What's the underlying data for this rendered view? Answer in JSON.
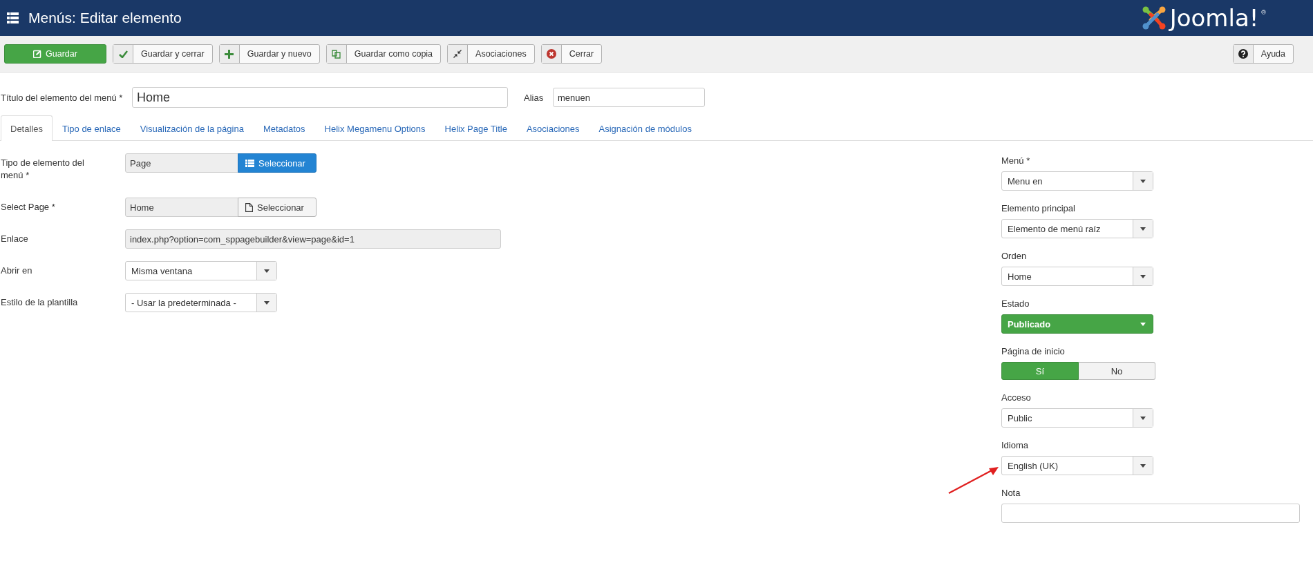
{
  "header": {
    "title": "Menús: Editar elemento",
    "logo_text": "Joomla!",
    "logo_mark": "®"
  },
  "toolbar": {
    "buttons": [
      {
        "label": "Guardar",
        "kind": "save"
      },
      {
        "label": "Guardar y cerrar",
        "kind": "save-close"
      },
      {
        "label": "Guardar y nuevo",
        "kind": "save-new"
      },
      {
        "label": "Guardar como copia",
        "kind": "save-copy"
      },
      {
        "label": "Asociaciones",
        "kind": "associations"
      },
      {
        "label": "Cerrar",
        "kind": "close"
      }
    ],
    "help": {
      "label": "Ayuda"
    }
  },
  "title_field": {
    "label": "Título del elemento del menú *",
    "value": "Home"
  },
  "alias_field": {
    "label": "Alias",
    "value": "menuen"
  },
  "tabs": [
    {
      "label": "Detalles",
      "selected": true
    },
    {
      "label": "Tipo de enlace",
      "selected": false
    },
    {
      "label": "Visualización de la página",
      "selected": false
    },
    {
      "label": "Metadatos",
      "selected": false
    },
    {
      "label": "Helix Megamenu Options",
      "selected": false
    },
    {
      "label": "Helix Page Title",
      "selected": false
    },
    {
      "label": "Asociaciones",
      "selected": false
    },
    {
      "label": "Asignación de módulos",
      "selected": false
    }
  ],
  "left_fields": [
    {
      "label": "Tipo de elemento del menú *",
      "kind": "picker-list",
      "value": "Page",
      "button_label": "Seleccionar"
    },
    {
      "label": "Select Page *",
      "kind": "picker-file",
      "value": "Home",
      "button_label": "Seleccionar"
    },
    {
      "label": "Enlace",
      "kind": "readonly",
      "value": "index.php?option=com_sppagebuilder&view=page&id=1"
    },
    {
      "label": "Abrir en",
      "kind": "select",
      "value": "Misma ventana"
    },
    {
      "label": "Estilo de la plantilla",
      "kind": "select",
      "value": "- Usar la predeterminada -"
    }
  ],
  "right_fields": [
    {
      "label": "Menú *",
      "kind": "select",
      "value": "Menu en"
    },
    {
      "label": "Elemento principal",
      "kind": "select",
      "value": "Elemento de menú raíz"
    },
    {
      "label": "Orden",
      "kind": "select",
      "value": "Home"
    },
    {
      "label": "Estado",
      "kind": "status",
      "value": "Publicado"
    },
    {
      "label": "Página de inicio",
      "kind": "toggle",
      "options": [
        {
          "label": "Sí",
          "selected": true
        },
        {
          "label": "No",
          "selected": false
        }
      ]
    },
    {
      "label": "Acceso",
      "kind": "select",
      "value": "Public"
    },
    {
      "label": "Idioma",
      "kind": "select",
      "value": "English (UK)"
    },
    {
      "label": "Nota",
      "kind": "text"
    }
  ]
}
